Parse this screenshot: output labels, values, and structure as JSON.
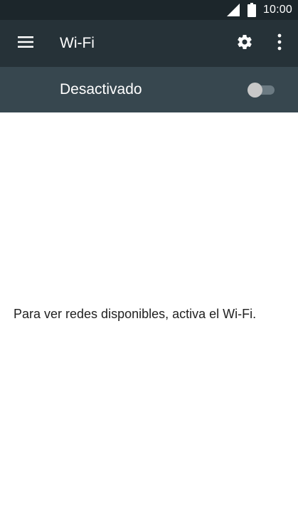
{
  "status_bar": {
    "time": "10:00",
    "signal_icon": "signal-icon",
    "battery_icon": "battery-icon"
  },
  "app_bar": {
    "menu_icon": "menu-icon",
    "title": "Wi-Fi",
    "settings_icon": "gear-icon",
    "overflow_icon": "more-vert-icon"
  },
  "toggle": {
    "label": "Desactivado",
    "state": "off"
  },
  "main": {
    "empty_message": "Para ver redes disponibles, activa el Wi-Fi."
  },
  "colors": {
    "status_bar": "#1c262b",
    "app_bar": "#263238",
    "toggle_bar": "#37474f",
    "background": "#ffffff",
    "text": "#212121"
  }
}
